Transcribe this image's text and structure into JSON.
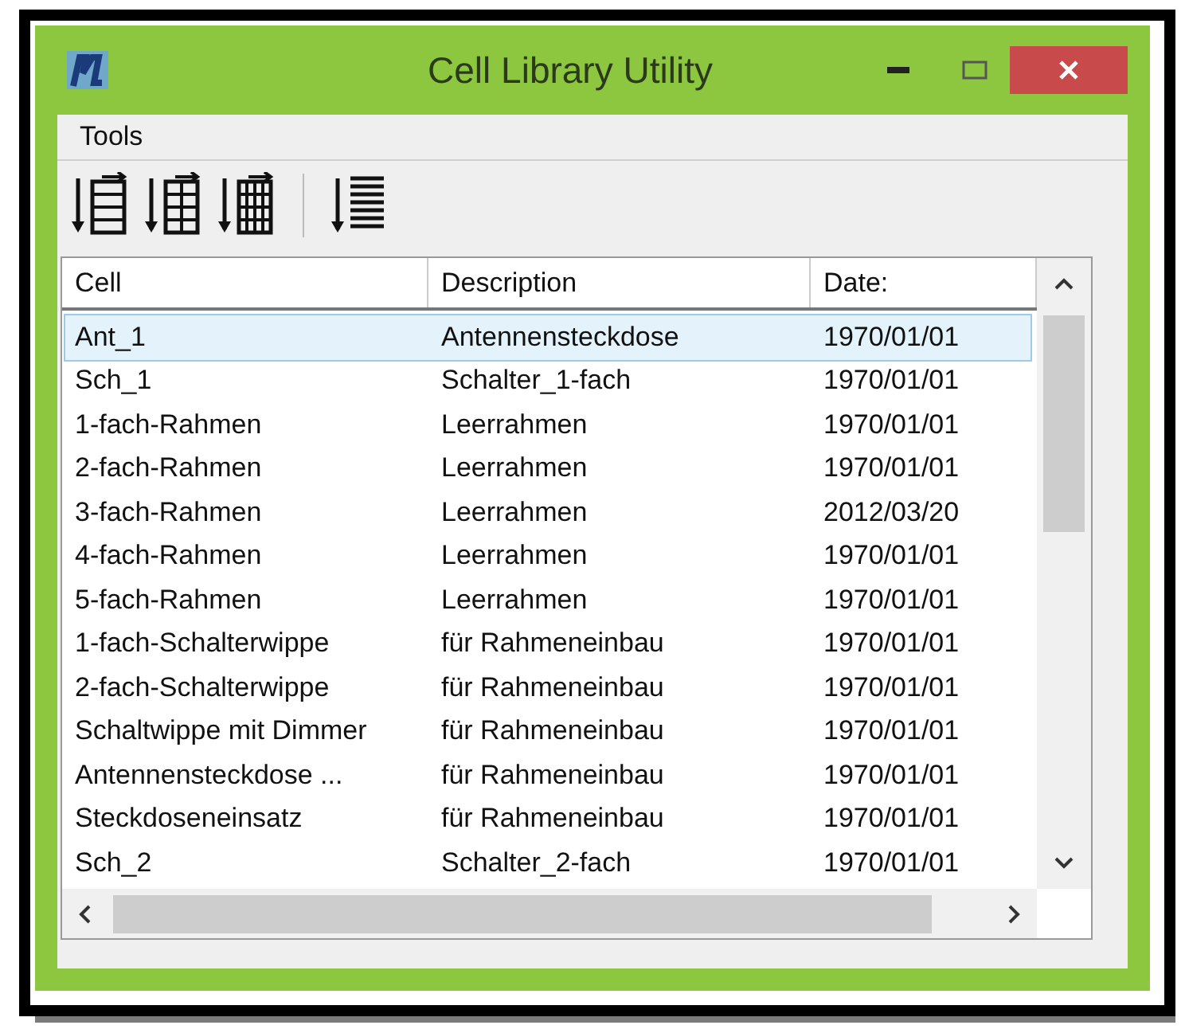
{
  "window": {
    "title": "Cell Library Utility"
  },
  "menu": [
    {
      "label": "Tools"
    }
  ],
  "toolbar": [
    {
      "kind": "table-2"
    },
    {
      "kind": "table-3"
    },
    {
      "kind": "table-4"
    },
    {
      "kind": "separator"
    },
    {
      "kind": "list"
    }
  ],
  "table": {
    "columns": [
      "Cell",
      "Description",
      "Date:"
    ],
    "rows": [
      {
        "cells": [
          "Ant_1",
          "Antennensteckdose",
          "1970/01/01"
        ],
        "selected": true
      },
      {
        "cells": [
          "Sch_1",
          "Schalter_1-fach",
          "1970/01/01"
        ],
        "selected": false
      },
      {
        "cells": [
          "1-fach-Rahmen",
          "Leerrahmen",
          "1970/01/01"
        ],
        "selected": false
      },
      {
        "cells": [
          "2-fach-Rahmen",
          "Leerrahmen",
          "1970/01/01"
        ],
        "selected": false
      },
      {
        "cells": [
          "3-fach-Rahmen",
          "Leerrahmen",
          "2012/03/20"
        ],
        "selected": false
      },
      {
        "cells": [
          "4-fach-Rahmen",
          "Leerrahmen",
          "1970/01/01"
        ],
        "selected": false
      },
      {
        "cells": [
          "5-fach-Rahmen",
          "Leerrahmen",
          "1970/01/01"
        ],
        "selected": false
      },
      {
        "cells": [
          "1-fach-Schalterwippe",
          "für Rahmeneinbau",
          "1970/01/01"
        ],
        "selected": false
      },
      {
        "cells": [
          "2-fach-Schalterwippe",
          "für Rahmeneinbau",
          "1970/01/01"
        ],
        "selected": false
      },
      {
        "cells": [
          "Schaltwippe mit Dimmer",
          "für Rahmeneinbau",
          "1970/01/01"
        ],
        "selected": false
      },
      {
        "cells": [
          "Antennensteckdose ...",
          "für Rahmeneinbau",
          "1970/01/01"
        ],
        "selected": false
      },
      {
        "cells": [
          "Steckdoseneinsatz",
          "für Rahmeneinbau",
          "1970/01/01"
        ],
        "selected": false
      },
      {
        "cells": [
          "Sch_2",
          "Schalter_2-fach",
          "1970/01/01"
        ],
        "selected": false
      }
    ]
  }
}
